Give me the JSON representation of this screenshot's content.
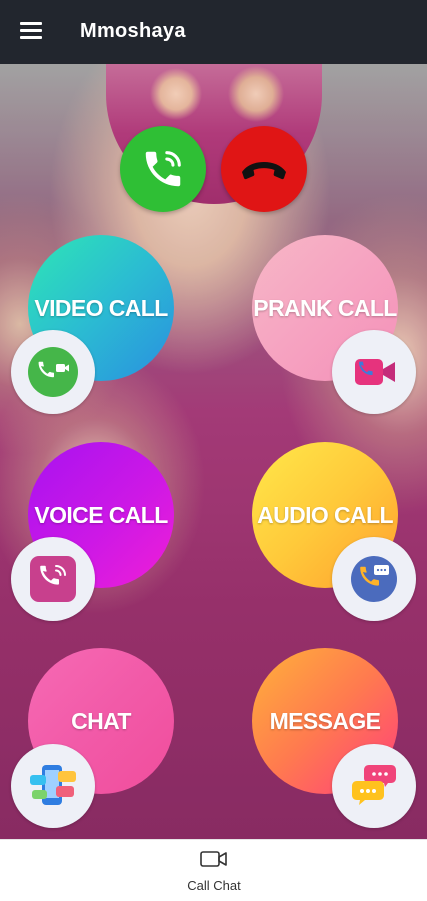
{
  "header": {
    "title": "Mmoshaya"
  },
  "incoming_call": {
    "accept_icon": "phone-accept-icon",
    "decline_icon": "phone-decline-icon"
  },
  "features": [
    {
      "label": "VIDEO CALL",
      "icon": "phone-video-icon"
    },
    {
      "label": "PRANK CALL",
      "icon": "video-camera-icon"
    },
    {
      "label": "VOICE CALL",
      "icon": "phone-ringing-icon"
    },
    {
      "label": "AUDIO CALL",
      "icon": "phone-chat-icon"
    },
    {
      "label": "CHAT",
      "icon": "chat-apps-icon"
    },
    {
      "label": "MESSAGE",
      "icon": "message-bubbles-icon"
    }
  ],
  "bottom_nav": {
    "item_label": "Call Chat",
    "icon": "video-camera-icon"
  },
  "colors": {
    "topbar": "#22262e",
    "accept": "#2fbf35",
    "decline": "#e01515",
    "video_call_gradient": [
      "#2ee6b5",
      "#2a8fe0"
    ],
    "prank_call_gradient": [
      "#f7b7c6",
      "#f490b8"
    ],
    "voice_call_gradient": [
      "#a812f0",
      "#f01fd6"
    ],
    "audio_call_gradient": [
      "#ffe84a",
      "#ff9f2e"
    ],
    "chat_gradient": [
      "#f25aa8",
      "#f04d9c"
    ],
    "message_gradient": [
      "#ffb23a",
      "#ff3d7d"
    ]
  }
}
